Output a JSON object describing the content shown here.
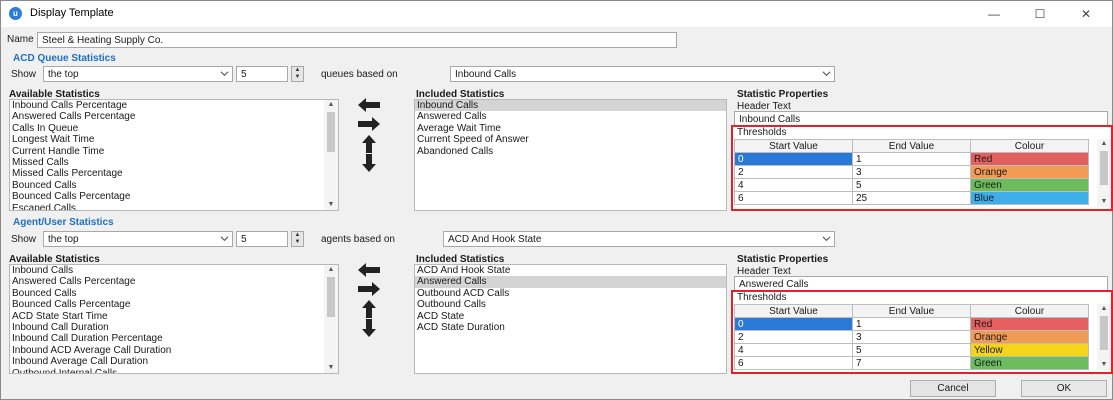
{
  "window": {
    "title": "Display Template",
    "icon": "app-logo-icon",
    "controls": [
      "minimize-icon",
      "maximize-icon",
      "close-icon"
    ]
  },
  "name": {
    "label": "Name",
    "value": "Steel & Heating Supply Co."
  },
  "acd": {
    "section_title": "ACD Queue Statistics",
    "show_label": "Show",
    "show_value": "the top",
    "count_value": "5",
    "based_on_label": "queues based on",
    "based_on_value": "Inbound Calls",
    "available_title": "Available Statistics",
    "available": [
      "Inbound Calls Percentage",
      "Answered Calls Percentage",
      "Calls In Queue",
      "Longest Wait Time",
      "Current Handle Time",
      "Missed Calls",
      "Missed Calls Percentage",
      "Bounced Calls",
      "Bounced Calls Percentage",
      "Escaped Calls"
    ],
    "included_title": "Included Statistics",
    "included": [
      "Inbound Calls",
      "Answered Calls",
      "Average Wait Time",
      "Current Speed of Answer",
      "Abandoned Calls"
    ],
    "props_title": "Statistic Properties",
    "header_text_label": "Header Text",
    "header_text_value": "Inbound Calls",
    "thresholds_label": "Thresholds",
    "columns": [
      "Start Value",
      "End Value",
      "Colour"
    ],
    "rows": [
      {
        "start": "0",
        "end": "1",
        "colour": "Red",
        "bg": "#e46060"
      },
      {
        "start": "2",
        "end": "3",
        "colour": "Orange",
        "bg": "#f29b55"
      },
      {
        "start": "4",
        "end": "5",
        "colour": "Green",
        "bg": "#6cbc5e"
      },
      {
        "start": "6",
        "end": "25",
        "colour": "Blue",
        "bg": "#3eaee8"
      }
    ]
  },
  "agent": {
    "section_title": "Agent/User Statistics",
    "show_label": "Show",
    "show_value": "the top",
    "count_value": "5",
    "based_on_label": "agents based on",
    "based_on_value": "ACD And Hook State",
    "available_title": "Available Statistics",
    "available": [
      "Inbound Calls",
      "Answered Calls Percentage",
      "Bounced Calls",
      "Bounced Calls Percentage",
      "ACD State Start Time",
      "Inbound Call Duration",
      "Inbound Call Duration Percentage",
      "Inbound ACD Average Call Duration",
      "Inbound Average Call Duration",
      "Outbound Internal Calls"
    ],
    "included_title": "Included Statistics",
    "included": [
      "ACD And Hook State",
      "Answered Calls",
      "Outbound ACD Calls",
      "Outbound Calls",
      "ACD State",
      "ACD State Duration"
    ],
    "props_title": "Statistic Properties",
    "header_text_label": "Header Text",
    "header_text_value": "Answered Calls",
    "thresholds_label": "Thresholds",
    "columns": [
      "Start Value",
      "End Value",
      "Colour"
    ],
    "rows": [
      {
        "start": "0",
        "end": "1",
        "colour": "Red",
        "bg": "#e46060"
      },
      {
        "start": "2",
        "end": "3",
        "colour": "Orange",
        "bg": "#f29b55"
      },
      {
        "start": "4",
        "end": "5",
        "colour": "Yellow",
        "bg": "#f4d51c"
      },
      {
        "start": "6",
        "end": "7",
        "colour": "Green",
        "bg": "#6cbc5e"
      }
    ]
  },
  "buttons": {
    "cancel": "Cancel",
    "ok": "OK"
  },
  "colors": {
    "accent": "#1f6fc0",
    "selection": "#2a79d6",
    "highlight_border": "#e0222c"
  }
}
